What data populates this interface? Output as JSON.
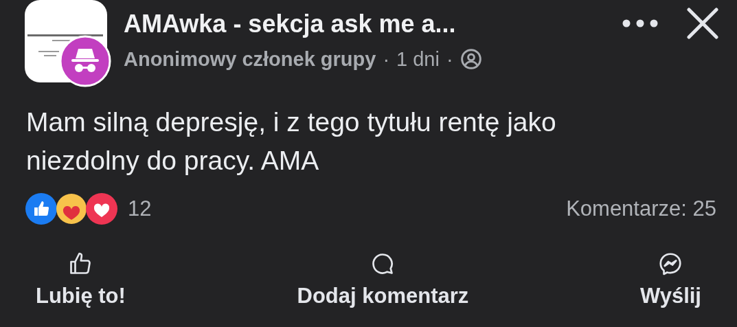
{
  "post": {
    "group_name": "AMAwka - sekcja ask me a...",
    "author": "Anonimowy członek grupy",
    "separator_1": "·",
    "time": "1 dni",
    "separator_2": "·",
    "text": "Mam silną depresję, i z tego tytułu rentę jako niezdolny do pracy. AMA"
  },
  "reactions": {
    "count": "12",
    "comments": "Komentarze: 25"
  },
  "actions": [
    {
      "kind": "like",
      "label": "Lubię to!"
    },
    {
      "kind": "comment",
      "label": "Dodaj komentarz"
    },
    {
      "kind": "send",
      "label": "Wyślij"
    }
  ]
}
